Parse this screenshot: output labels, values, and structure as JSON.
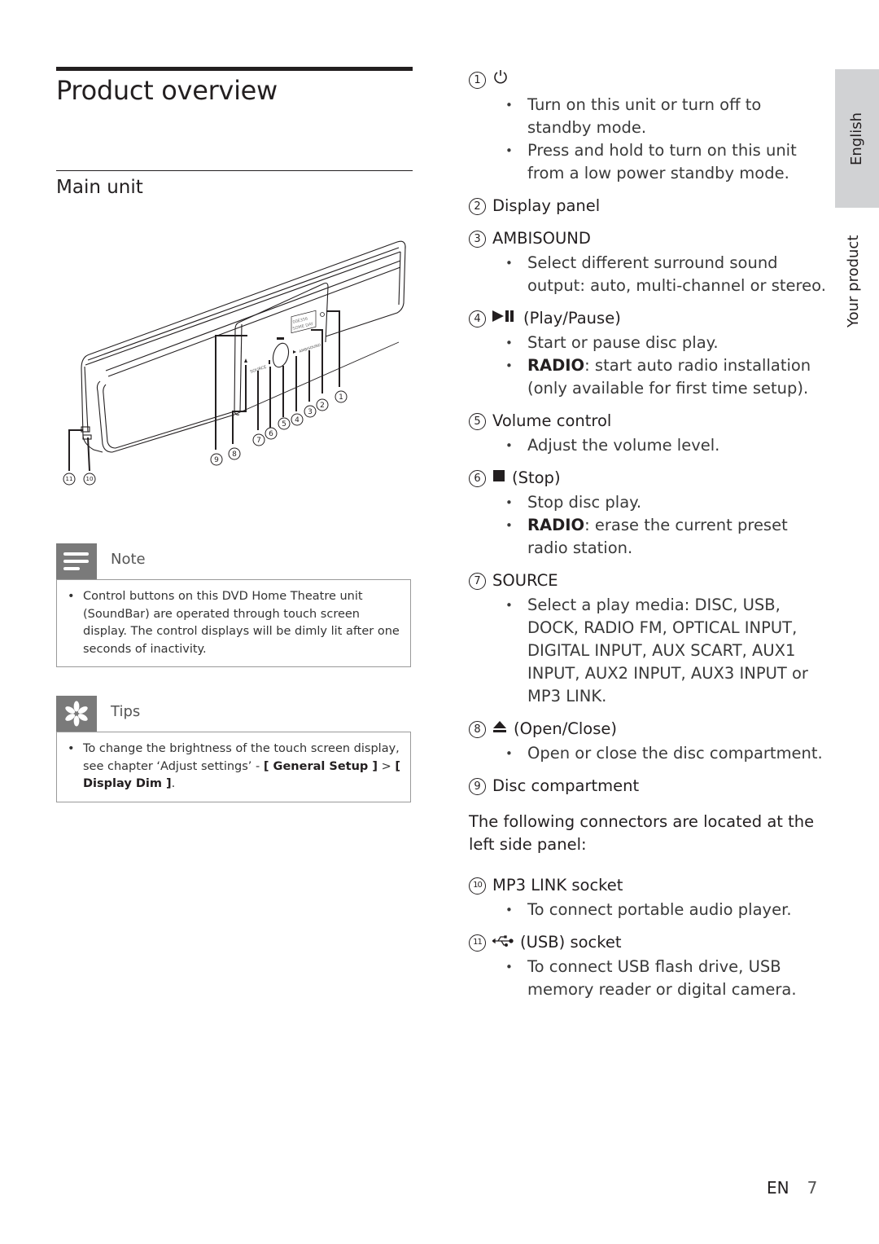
{
  "page": {
    "title": "Product overview",
    "section_title": "Main unit",
    "side_tab": {
      "language": "English",
      "chapter": "Your product"
    },
    "footer": {
      "lang_code": "EN",
      "page_number": "7"
    }
  },
  "diagram": {
    "labels": [
      "1",
      "2",
      "3",
      "4",
      "5",
      "6",
      "7",
      "8",
      "9",
      "10",
      "11"
    ],
    "panel_text": {
      "source": "SOURCE",
      "ambisound": "AMBISOUND",
      "display_line1": "00E356",
      "display_line2": "SOME DAY"
    }
  },
  "note": {
    "icon": "note-lines-icon",
    "label": "Note",
    "items": [
      "Control buttons on this DVD Home Theatre unit (SoundBar) are operated through touch screen display. The control displays will be dimly lit after one seconds of inactivity."
    ]
  },
  "tips": {
    "icon": "asterisk-icon",
    "label": "Tips",
    "text_before": "To change the brightness of the touch screen display, see chapter ‘Adjust settings’ - ",
    "bold1": "[ General Setup ]",
    "sep": " > ",
    "bold2": "[ Display Dim ]",
    "text_after": "."
  },
  "items": [
    {
      "num": "1",
      "icon": "power-icon",
      "glyph": "⏻",
      "title": "",
      "bullets": [
        {
          "bold": "",
          "text": "Turn on this unit or turn off to standby mode."
        },
        {
          "bold": "",
          "text": "Press and hold to turn on this unit from a low power standby mode."
        }
      ]
    },
    {
      "num": "2",
      "title": "Display panel",
      "bullets": []
    },
    {
      "num": "3",
      "title": "AMBISOUND",
      "bullets": [
        {
          "bold": "",
          "text": "Select different surround sound output: auto, multi-channel or stereo."
        }
      ]
    },
    {
      "num": "4",
      "icon": "play-pause-icon",
      "glyph": "▶❚❚",
      "title": "(Play/Pause)",
      "bullets": [
        {
          "bold": "",
          "text": "Start or pause disc play."
        },
        {
          "bold": "RADIO",
          "text": ": start auto radio installation (only available for first time setup)."
        }
      ]
    },
    {
      "num": "5",
      "title": "Volume control",
      "bullets": [
        {
          "bold": "",
          "text": "Adjust the volume level."
        }
      ]
    },
    {
      "num": "6",
      "icon": "stop-icon",
      "glyph": "■",
      "title": "(Stop)",
      "bullets": [
        {
          "bold": "",
          "text": "Stop disc play."
        },
        {
          "bold": "RADIO",
          "text": ": erase the current preset radio station."
        }
      ]
    },
    {
      "num": "7",
      "title": "SOURCE",
      "bullets": [
        {
          "bold": "",
          "text": "Select a play media: DISC, USB, DOCK, RADIO FM, OPTICAL INPUT, DIGITAL INPUT, AUX SCART, AUX1 INPUT, AUX2 INPUT, AUX3 INPUT or MP3 LINK."
        }
      ]
    },
    {
      "num": "8",
      "icon": "eject-icon",
      "glyph": "⏏",
      "title": "(Open/Close)",
      "bullets": [
        {
          "bold": "",
          "text": "Open or close the disc compartment."
        }
      ]
    },
    {
      "num": "9",
      "title": "Disc compartment",
      "bullets": []
    }
  ],
  "connectors_intro": "The following connectors are located at the left side panel:",
  "connectors": [
    {
      "num": "10",
      "title": "MP3 LINK socket",
      "bullets": [
        {
          "bold": "",
          "text": "To connect portable audio player."
        }
      ]
    },
    {
      "num": "11",
      "icon": "usb-icon",
      "glyph": "⭠",
      "title": "(USB) socket",
      "bullets": [
        {
          "bold": "",
          "text": "To connect USB flash drive, USB memory reader or digital camera."
        }
      ]
    }
  ]
}
